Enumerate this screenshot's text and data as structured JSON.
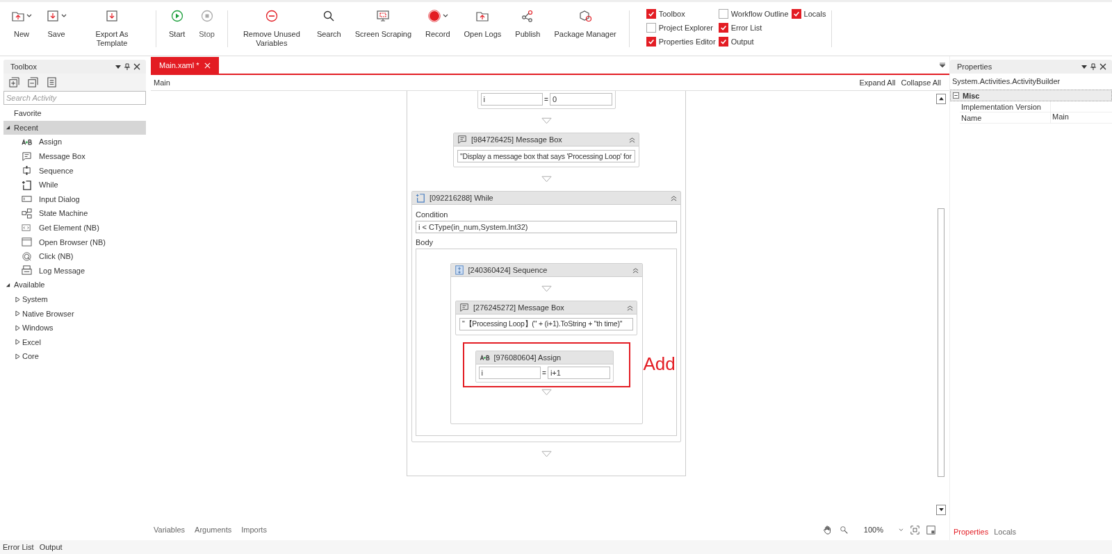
{
  "toolbar": {
    "groups": [
      [
        {
          "kind": "new",
          "label": "New",
          "dropdown": true,
          "disabled": false
        },
        {
          "kind": "save",
          "label": "Save",
          "dropdown": true,
          "disabled": false
        },
        {
          "kind": "export",
          "label": "Export As Template",
          "dropdown": false,
          "disabled": false
        }
      ],
      [
        {
          "kind": "start",
          "label": "Start",
          "dropdown": false,
          "disabled": false
        },
        {
          "kind": "stop",
          "label": "Stop",
          "dropdown": false,
          "disabled": true
        }
      ],
      [
        {
          "kind": "remove",
          "label": "Remove Unused Variables",
          "dropdown": false,
          "disabled": false
        },
        {
          "kind": "search",
          "label": "Search",
          "dropdown": false,
          "disabled": false
        },
        {
          "kind": "scraping",
          "label": "Screen Scraping",
          "dropdown": false,
          "disabled": false
        },
        {
          "kind": "record",
          "label": "Record",
          "dropdown": true,
          "disabled": false
        },
        {
          "kind": "logs",
          "label": "Open Logs",
          "dropdown": false,
          "disabled": false
        },
        {
          "kind": "publish",
          "label": "Publish",
          "dropdown": false,
          "disabled": false
        },
        {
          "kind": "package",
          "label": "Package Manager",
          "dropdown": false,
          "disabled": false
        }
      ]
    ],
    "panel_toggles": [
      [
        {
          "label": "Toolbox",
          "checked": true
        },
        {
          "label": "Project Explorer",
          "checked": false
        },
        {
          "label": "Properties Editor",
          "checked": true
        }
      ],
      [
        {
          "label": "Workflow Outline",
          "checked": false
        },
        {
          "label": "Error List",
          "checked": true
        },
        {
          "label": "Output",
          "checked": true
        }
      ],
      [
        {
          "label": "Locals",
          "checked": true
        }
      ]
    ]
  },
  "toolbox": {
    "title": "Toolbox",
    "search": {
      "placeholder": "Search Activity"
    },
    "tree": [
      {
        "label": "Favorite",
        "expanded": false,
        "selected": false
      },
      {
        "label": "Recent",
        "expanded": true,
        "selected": true,
        "children": [
          {
            "label": "Assign",
            "kind": "assign"
          },
          {
            "label": "Message Box",
            "kind": "message"
          },
          {
            "label": "Sequence",
            "kind": "sequence"
          },
          {
            "label": "While",
            "kind": "while"
          },
          {
            "label": "Input Dialog",
            "kind": "input"
          },
          {
            "label": "State Machine",
            "kind": "state"
          },
          {
            "label": "Get Element (NB)",
            "kind": "element"
          },
          {
            "label": "Open Browser (NB)",
            "kind": "browser"
          },
          {
            "label": "Click (NB)",
            "kind": "click"
          },
          {
            "label": "Log Message",
            "kind": "log"
          }
        ]
      },
      {
        "label": "Available",
        "expanded": true,
        "selected": false,
        "children": [
          {
            "label": "System",
            "expanded": false
          },
          {
            "label": "Native Browser",
            "expanded": false
          },
          {
            "label": "Windows",
            "expanded": false
          },
          {
            "label": "Excel",
            "expanded": false
          },
          {
            "label": "Core",
            "expanded": false
          }
        ]
      }
    ]
  },
  "editor": {
    "tabs": [
      {
        "label": "Main.xaml *",
        "selected": true
      }
    ],
    "breadcrumb": "Main",
    "expand_all": "Expand All",
    "collapse_all": "Collapse All",
    "top_assign": {
      "to": "i",
      "operator": "=",
      "value": "0"
    },
    "message_box": {
      "header": "[984726425] Message Box",
      "text": "\"Display a message box that says 'Processing Loop' for"
    },
    "while": {
      "header": "[092216288] While",
      "condition_label": "Condition",
      "condition": "i < CType(in_num,System.Int32)",
      "body_label": "Body",
      "sequence": {
        "header": "[240360424] Sequence",
        "message_box": {
          "header": "[276245272] Message Box",
          "text": "\"【Processing Loop】(\" + (i+1).ToString + \"th time)\""
        },
        "assign": {
          "header": "[976080604] Assign",
          "to": "i",
          "operator": "=",
          "value": "i+1"
        }
      }
    },
    "annotation": {
      "label": "Add"
    },
    "bottom_tabs": [
      "Variables",
      "Arguments",
      "Imports"
    ],
    "zoom": "100%"
  },
  "properties": {
    "title": "Properties",
    "object": "System.Activities.ActivityBuilder",
    "category": {
      "label": "Misc",
      "expanded": true
    },
    "rows": [
      {
        "name": "Implementation Version",
        "value": ""
      },
      {
        "name": "Name",
        "value": "Main"
      }
    ],
    "tabs": [
      {
        "label": "Properties",
        "selected": true
      },
      {
        "label": "Locals",
        "selected": false
      }
    ]
  },
  "status_bar": {
    "tabs": [
      "Error List",
      "Output"
    ]
  }
}
